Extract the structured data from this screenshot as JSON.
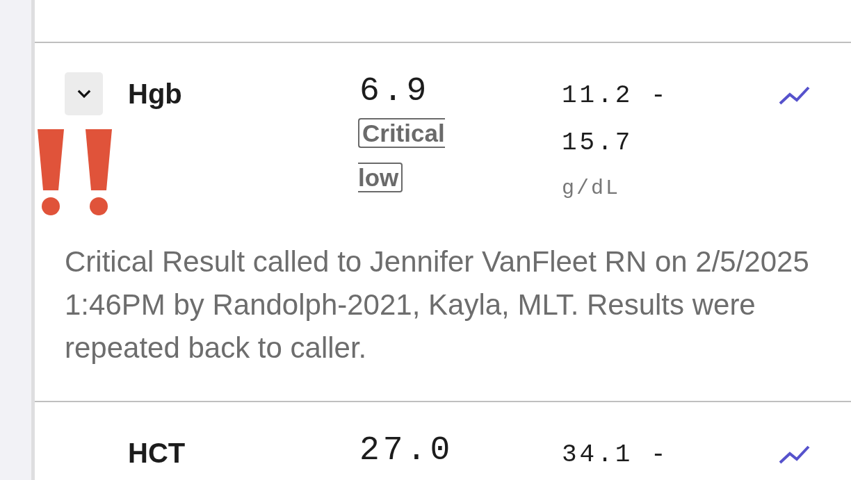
{
  "results": [
    {
      "test": "Hgb",
      "details_toggle": {
        "expanded": true
      },
      "alert": true,
      "value": "6.9",
      "flag": "Critical low",
      "reference_range": "11.2 - 15.7",
      "unit": "g/dL",
      "comment": "Critical Result called to Jennifer VanFleet RN on 2/5/2025 1:46PM by Randolph-2021, Kayla, MLT. Results were repeated back to caller."
    },
    {
      "test": "HCT",
      "alert": false,
      "value": "27.0",
      "reference_range": "34.1 -"
    }
  ]
}
